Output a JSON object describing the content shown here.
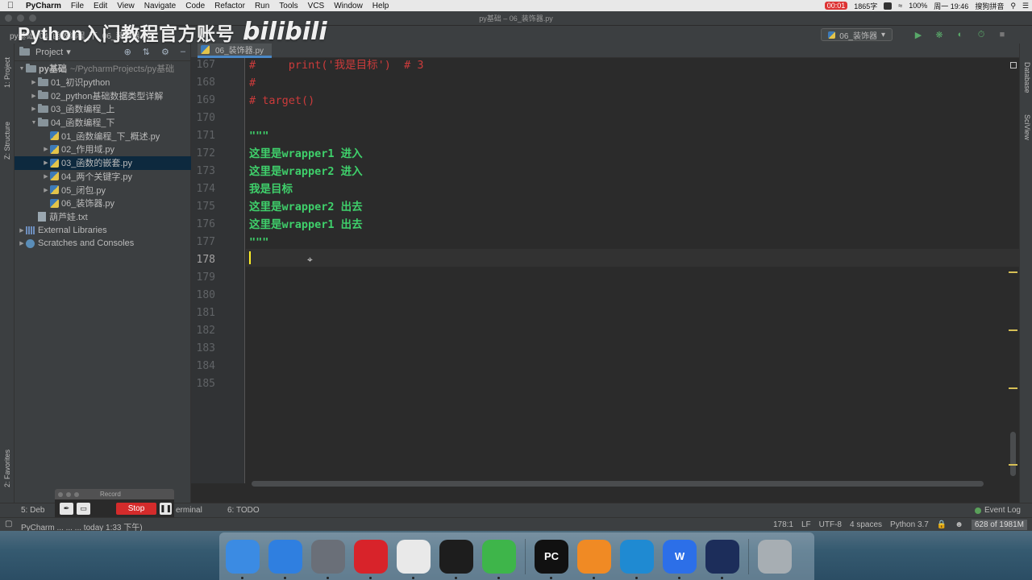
{
  "menubar": {
    "items": [
      "PyCharm",
      "File",
      "Edit",
      "View",
      "Navigate",
      "Code",
      "Refactor",
      "Run",
      "Tools",
      "VCS",
      "Window",
      "Help"
    ],
    "rec_time": "00:01",
    "word_count": "1865字",
    "battery": "100%",
    "clock": "周一 19:46",
    "ime": "搜狗拼音"
  },
  "window": {
    "title": "py基础 – 06_装饰器.py"
  },
  "watermark": {
    "text": "Python入门教程官方账号",
    "logo": "bilibili"
  },
  "breadcrumb": [
    "py基础",
    "04_函数编程_下",
    "06_装饰器.py"
  ],
  "run_config": {
    "label": "06_装饰器"
  },
  "project_panel": {
    "title": "Project",
    "tree": [
      {
        "label": "py基础",
        "extra": "~/PycharmProjects/py基础",
        "type": "folder",
        "depth": 0,
        "expanded": true
      },
      {
        "label": "01_初识python",
        "type": "folder",
        "depth": 1,
        "expanded": false
      },
      {
        "label": "02_python基础数据类型详解",
        "type": "folder",
        "depth": 1,
        "expanded": false
      },
      {
        "label": "03_函数编程_上",
        "type": "folder",
        "depth": 1,
        "expanded": false
      },
      {
        "label": "04_函数编程_下",
        "type": "folder",
        "depth": 1,
        "expanded": true
      },
      {
        "label": "01_函数编程_下_概述.py",
        "type": "py",
        "depth": 2
      },
      {
        "label": "02_作用域.py",
        "type": "py",
        "depth": 2,
        "arrow": true
      },
      {
        "label": "03_函数的嵌套.py",
        "type": "py",
        "depth": 2,
        "arrow": true,
        "selected": true
      },
      {
        "label": "04_两个关键字.py",
        "type": "py",
        "depth": 2,
        "arrow": true
      },
      {
        "label": "05_闭包.py",
        "type": "py",
        "depth": 2,
        "arrow": true
      },
      {
        "label": "06_装饰器.py",
        "type": "py",
        "depth": 2
      },
      {
        "label": "葫芦娃.txt",
        "type": "txt",
        "depth": 1
      },
      {
        "label": "External Libraries",
        "type": "lib",
        "depth": 0,
        "expanded": false
      },
      {
        "label": "Scratches and Consoles",
        "type": "scratch",
        "depth": 0,
        "expanded": false
      }
    ]
  },
  "left_tool_tabs": {
    "project": "1: Project",
    "structure": "Z: Structure",
    "favorites": "2: Favorites"
  },
  "right_tool_tabs": {
    "database": "Database",
    "sciview": "SciView"
  },
  "editor": {
    "tab_label": "06_装饰器.py",
    "lines": [
      {
        "num": "167",
        "text": "#     print('我是目标')  # 3",
        "kind": "comment"
      },
      {
        "num": "168",
        "text": "#",
        "kind": "comment"
      },
      {
        "num": "169",
        "text": "# target()",
        "kind": "comment"
      },
      {
        "num": "170",
        "text": "",
        "kind": "plain"
      },
      {
        "num": "171",
        "text": "\"\"\"",
        "kind": "str"
      },
      {
        "num": "172",
        "text": "这里是wrapper1 进入",
        "kind": "str"
      },
      {
        "num": "173",
        "text": "这里是wrapper2 进入",
        "kind": "str"
      },
      {
        "num": "174",
        "text": "我是目标",
        "kind": "str"
      },
      {
        "num": "175",
        "text": "这里是wrapper2 出去",
        "kind": "str"
      },
      {
        "num": "176",
        "text": "这里是wrapper1 出去",
        "kind": "str"
      },
      {
        "num": "177",
        "text": "\"\"\"",
        "kind": "str"
      },
      {
        "num": "178",
        "text": "",
        "kind": "plain",
        "current": true
      },
      {
        "num": "179",
        "text": "",
        "kind": "plain"
      },
      {
        "num": "180",
        "text": "",
        "kind": "plain"
      },
      {
        "num": "181",
        "text": "",
        "kind": "plain"
      },
      {
        "num": "182",
        "text": "",
        "kind": "plain"
      },
      {
        "num": "183",
        "text": "",
        "kind": "plain"
      },
      {
        "num": "184",
        "text": "",
        "kind": "plain"
      },
      {
        "num": "185",
        "text": "",
        "kind": "plain"
      }
    ]
  },
  "bottom_tabs": {
    "debug": "5: Deb",
    "terminal": "erminal",
    "todo": "6: TODO",
    "event_log": "Event Log"
  },
  "statusbar": {
    "message": "PyCharm ... ... ... today 1:33 下午)",
    "position": "178:1",
    "line_sep": "LF",
    "encoding": "UTF-8",
    "indent": "4 spaces",
    "interpreter": "Python 3.7",
    "memory": "628 of 1981M"
  },
  "recorder": {
    "title": "Record",
    "stop_label": "Stop"
  },
  "dock": {
    "apps": [
      {
        "name": "finder-icon",
        "label": "",
        "color": "#3b8be3"
      },
      {
        "name": "safari-icon",
        "label": "",
        "color": "#2f7fe0"
      },
      {
        "name": "launchpad-icon",
        "label": "",
        "color": "#6a6f78"
      },
      {
        "name": "netease-music-icon",
        "label": "",
        "color": "#d8232a"
      },
      {
        "name": "chrome-icon",
        "label": "",
        "color": "#e9e9e9"
      },
      {
        "name": "qq-icon",
        "label": "",
        "color": "#1d1d1d"
      },
      {
        "name": "wechat-icon",
        "label": "",
        "color": "#3eb54a"
      },
      {
        "name": "pycharm-icon",
        "label": "PC",
        "color": "#111111"
      },
      {
        "name": "video-app-icon",
        "label": "",
        "color": "#f08a24"
      },
      {
        "name": "vscode-icon",
        "label": "",
        "color": "#1f8ad2"
      },
      {
        "name": "wps-icon",
        "label": "W",
        "color": "#2c6fe8"
      },
      {
        "name": "lightning-app-icon",
        "label": "",
        "color": "#1c2d5a"
      },
      {
        "name": "trash-icon",
        "label": "",
        "color": "#a7aeb3"
      }
    ]
  }
}
